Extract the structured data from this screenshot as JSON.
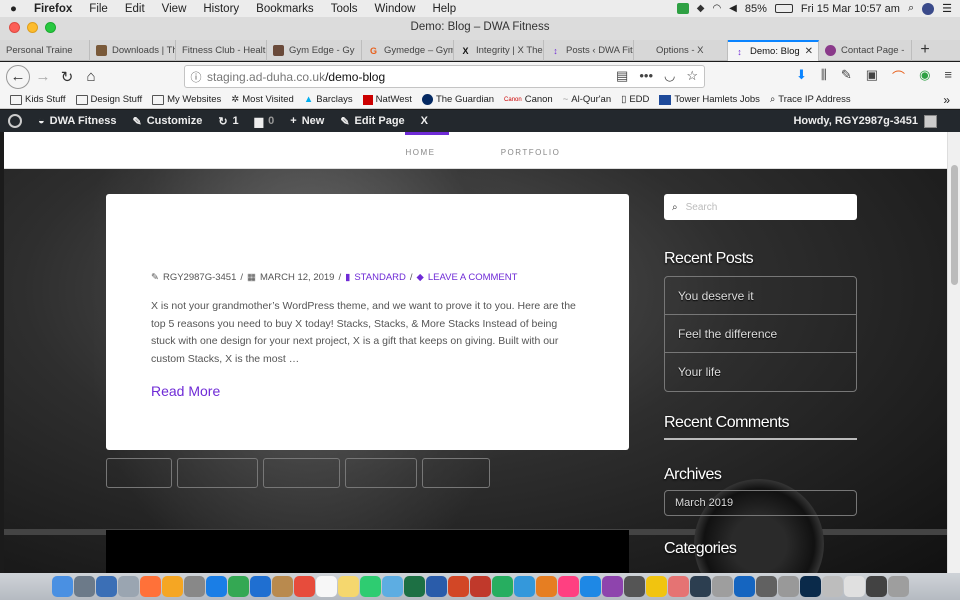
{
  "menubar": {
    "app_name": "Firefox",
    "items": [
      "File",
      "Edit",
      "View",
      "History",
      "Bookmarks",
      "Tools",
      "Window",
      "Help"
    ],
    "battery": "85%",
    "datetime": "Fri 15 Mar  10:57 am"
  },
  "window": {
    "title": "Demo: Blog – DWA Fitness"
  },
  "tabs": [
    {
      "label": "Personal Traine",
      "fav_color": "#999"
    },
    {
      "label": "Downloads | Th",
      "fav_color": "#7a5a3a"
    },
    {
      "label": "Fitness Club - Healt",
      "fav_color": "#ccc"
    },
    {
      "label": "Gym Edge - Gy",
      "fav_color": "#6a4a3a"
    },
    {
      "label": "Gymedge – Gym",
      "fav_color": "#e8601c",
      "fav_glyph": "G"
    },
    {
      "label": "Integrity | X The",
      "fav_color": "#ffffff",
      "fav_glyph": "X"
    },
    {
      "label": "Posts ‹ DWA Fit",
      "fav_color": "#6f2bd6",
      "fav_glyph": "↕"
    },
    {
      "label": "Options - X",
      "fav_color": "#ffffff",
      "fav_glyph": ""
    },
    {
      "label": "Demo: Blog",
      "fav_color": "#6f2bd6",
      "fav_glyph": "↕",
      "active": true
    },
    {
      "label": "Contact Page -",
      "fav_color": "#8a3a8a"
    }
  ],
  "url": {
    "host": "staging.ad-duha.co.uk",
    "path": "/demo-blog"
  },
  "bookmarks": [
    {
      "label": "Kids Stuff",
      "icon": "folder-icon"
    },
    {
      "label": "Design Stuff",
      "icon": "folder-icon"
    },
    {
      "label": "My Websites",
      "icon": "folder-icon"
    },
    {
      "label": "Most Visited",
      "icon": "gear-icon"
    },
    {
      "label": "Barclays",
      "icon": "barclays-icon"
    },
    {
      "label": "NatWest",
      "icon": "natwest-icon"
    },
    {
      "label": "The Guardian",
      "icon": "guardian-icon"
    },
    {
      "label": "Canon",
      "icon": "canon-icon"
    },
    {
      "label": "Al-Qur'an",
      "icon": "quran-icon"
    },
    {
      "label": "EDD",
      "icon": "doc-icon"
    },
    {
      "label": "Tower Hamlets Jobs",
      "icon": "th-icon"
    },
    {
      "label": "Trace IP Address",
      "icon": "search-icon"
    }
  ],
  "wpbar": {
    "site_name": "DWA Fitness",
    "customize": "Customize",
    "updates": "1",
    "comments": "0",
    "new_label": "New",
    "edit_page": "Edit Page",
    "x_label": "X",
    "howdy": "Howdy, RGY2987g-3451"
  },
  "site_nav": {
    "items": [
      "HOME",
      "PORTFOLIO"
    ]
  },
  "post": {
    "author": "RGY2987G-3451",
    "date": "MARCH 12, 2019",
    "format": "STANDARD",
    "comment_link": "LEAVE A COMMENT",
    "excerpt": "X is not your grandmother’s WordPress theme, and we want to prove it to you. Here are the top 5 reasons you need to buy X today! Stacks, Stacks, & More Stacks Instead of being stuck with one design for your next project, X is a gift that keeps on giving. Built with our custom Stacks, X is the most …",
    "read_more": "Read More"
  },
  "sidebar": {
    "search_placeholder": "Search",
    "recent_posts_title": "Recent Posts",
    "recent_posts": [
      "You deserve it",
      "Feel the difference",
      "Your life"
    ],
    "recent_comments_title": "Recent Comments",
    "archives_title": "Archives",
    "archives": [
      "March 2019"
    ],
    "categories_title": "Categories"
  },
  "dock_colors": [
    "#4a90e2",
    "#6c7a89",
    "#3b6fb6",
    "#9aa5b1",
    "#ff7139",
    "#f5a623",
    "#888",
    "#1a7ee6",
    "#34a853",
    "#1f6fd1",
    "#b98a4e",
    "#e74c3c",
    "#f7f7f7",
    "#f5d76e",
    "#2ecc71",
    "#5dade2",
    "#1d7044",
    "#2a5caa",
    "#d24726",
    "#c0392b",
    "#27ae60",
    "#3498db",
    "#e67e22",
    "#ff4081",
    "#1e88e5",
    "#8e44ad",
    "#555",
    "#f1c40f",
    "#e57373",
    "#2c3e50",
    "#9e9e9e",
    "#1565c0",
    "#616161",
    "#999",
    "#0a2a4a",
    "#bdbdbd",
    "#e0e0e0",
    "#424242",
    "#9e9e9e"
  ]
}
